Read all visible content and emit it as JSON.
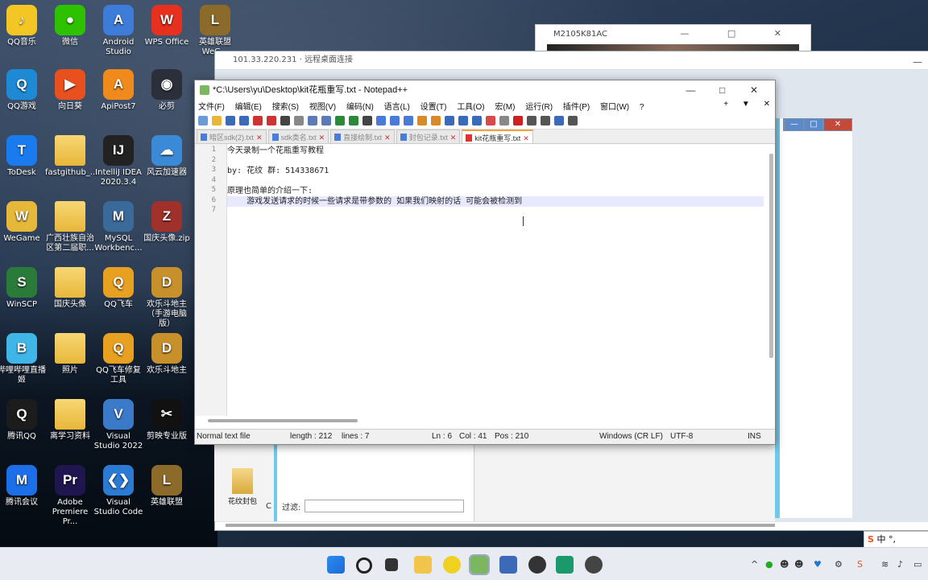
{
  "desktop_icons": [
    {
      "label": "QQ音乐",
      "glyph": "♪",
      "color": "#f3c623"
    },
    {
      "label": "微信",
      "glyph": "●",
      "color": "#2dc100"
    },
    {
      "label": "Android Studio",
      "glyph": "A",
      "color": "#3d7cd8"
    },
    {
      "label": "WPS Office",
      "glyph": "W",
      "color": "#e8301e"
    },
    {
      "label": "英雄联盟 WeG...",
      "glyph": "L",
      "color": "#8c6a2a"
    },
    {
      "label": "QQ游戏",
      "glyph": "Q",
      "color": "#1e8ad6"
    },
    {
      "label": "向日葵",
      "glyph": "▶",
      "color": "#e8501e"
    },
    {
      "label": "ApiPost7",
      "glyph": "A",
      "color": "#f08a1c"
    },
    {
      "label": "必剪",
      "glyph": "◉",
      "color": "#2a2f3a"
    },
    {
      "label": "ToDesk",
      "glyph": "T",
      "color": "#1a7bef"
    },
    {
      "label": "fastgithub_...",
      "glyph": "",
      "color": "folder"
    },
    {
      "label": "IntelliJ IDEA 2020.3.4",
      "glyph": "IJ",
      "color": "#222222"
    },
    {
      "label": "风云加速器",
      "glyph": "☁",
      "color": "#3b8ad8"
    },
    {
      "label": "WeGame",
      "glyph": "W",
      "color": "#e6b83a"
    },
    {
      "label": "广西壮族自治区第二届职...",
      "glyph": "",
      "color": "folder"
    },
    {
      "label": "MySQL Workbenc...",
      "glyph": "M",
      "color": "#3a6a9a"
    },
    {
      "label": "国庆头像.zip",
      "glyph": "Z",
      "color": "#a0302a"
    },
    {
      "label": "WinSCP",
      "glyph": "S",
      "color": "#2a7a3a"
    },
    {
      "label": "国庆头像",
      "glyph": "",
      "color": "folder"
    },
    {
      "label": "QQ飞车",
      "glyph": "Q",
      "color": "#e8a020"
    },
    {
      "label": "欢乐斗地主（手游电脑版）",
      "glyph": "D",
      "color": "#c8902a"
    },
    {
      "label": "哔哩哔哩直播姬",
      "glyph": "B",
      "color": "#3fb5e8"
    },
    {
      "label": "照片",
      "glyph": "",
      "color": "folder"
    },
    {
      "label": "QQ飞车修复工具",
      "glyph": "Q",
      "color": "#e8a020"
    },
    {
      "label": "欢乐斗地主",
      "glyph": "D",
      "color": "#c8902a"
    },
    {
      "label": "腾讯QQ",
      "glyph": "Q",
      "color": "#1c1c1c"
    },
    {
      "label": "离学习资料",
      "glyph": "",
      "color": "folder"
    },
    {
      "label": "Visual Studio 2022",
      "glyph": "V",
      "color": "#3b79c9"
    },
    {
      "label": "剪映专业版",
      "glyph": "✂",
      "color": "#111111"
    },
    {
      "label": "腾讯会议",
      "glyph": "M",
      "color": "#1c6fe8"
    },
    {
      "label": "Adobe Premiere Pr...",
      "glyph": "Pr",
      "color": "#1f1650"
    },
    {
      "label": "Visual Studio Code",
      "glyph": "❮❯",
      "color": "#2b7bd5"
    },
    {
      "label": "英雄联盟",
      "glyph": "L",
      "color": "#8c6a2a"
    }
  ],
  "phone_window": {
    "title": "M2105K81AC",
    "controls": [
      "—",
      "□",
      "✕"
    ]
  },
  "remote_desktop": {
    "title": "101.33.220.231 · 远程桌面连接",
    "right_controls": [
      "—",
      "□",
      "✕"
    ],
    "folder_label": "花纹封包",
    "filter_label": "过滤:",
    "letter": "C"
  },
  "notepad": {
    "title": "*C:\\Users\\yu\\Desktop\\kit花瓶重写.txt - Notepad++",
    "window_controls": [
      "—",
      "□",
      "✕"
    ],
    "menus": [
      "文件(F)",
      "编辑(E)",
      "搜索(S)",
      "视图(V)",
      "编码(N)",
      "语言(L)",
      "设置(T)",
      "工具(O)",
      "宏(M)",
      "运行(R)",
      "插件(P)",
      "窗口(W)",
      "?"
    ],
    "menu_right": [
      "+",
      "▼",
      "✕"
    ],
    "tabs": [
      {
        "label": "暗区sdk(2).txt"
      },
      {
        "label": "sdk类名.txt"
      },
      {
        "label": "直接绘制.txt"
      },
      {
        "label": "封包记录.txt"
      },
      {
        "label": "kit花瓶重写.txt"
      }
    ],
    "lines": [
      {
        "n": "1",
        "text": "今天录制一个花瓶重写教程"
      },
      {
        "n": "2",
        "text": ""
      },
      {
        "n": "3",
        "text": "by: 花纹 群: 514338671"
      },
      {
        "n": "4",
        "text": ""
      },
      {
        "n": "5",
        "text": "原理也简单的介绍一下:"
      },
      {
        "n": "6",
        "text": "    游戏发送请求的时候一些请求是带参数的 如果我们映射的话 可能会被检测到"
      },
      {
        "n": "7",
        "text": ""
      }
    ],
    "status": {
      "type": "Normal text file",
      "length": "length : 212",
      "lines": "lines : 7",
      "ln": "Ln : 6",
      "col": "Col : 41",
      "pos": "Pos : 210",
      "eol": "Windows (CR LF)",
      "enc": "UTF-8",
      "ins": "INS"
    }
  },
  "taskbar": {
    "ime": "中",
    "ime_extra": "°,"
  }
}
